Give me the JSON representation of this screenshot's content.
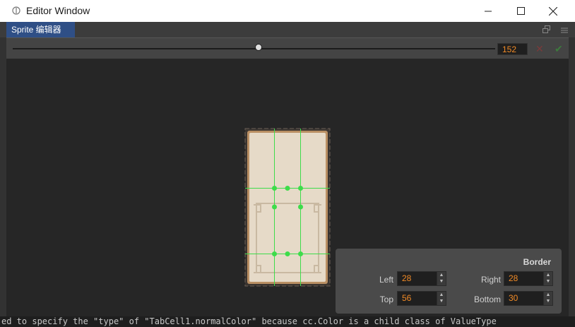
{
  "window": {
    "title": "Editor Window"
  },
  "tab": {
    "label": "Sprite 编辑器"
  },
  "toolbar": {
    "zoom_value": "152",
    "slider_fraction": 0.51
  },
  "border_panel": {
    "title": "Border",
    "left_label": "Left",
    "left_value": "28",
    "right_label": "Right",
    "right_value": "28",
    "top_label": "Top",
    "top_value": "56",
    "bottom_label": "Bottom",
    "bottom_value": "30"
  },
  "console": {
    "text": "ed to specify the \"type\" of \"TabCell1.normalColor\" because cc.Color is a child class of ValueType"
  },
  "colors": {
    "accent": "#f08a26",
    "tab_active": "#2f4f86",
    "guide_green": "#3ddc4a",
    "sprite_fill": "#e6dac8"
  },
  "icons": {
    "app": "app-icon",
    "minimize": "minimize-icon",
    "maximize": "maximize-icon",
    "close": "close-icon",
    "popout": "popout-icon",
    "menu": "menu-icon",
    "cancel": "cancel-icon",
    "confirm": "check-icon"
  }
}
